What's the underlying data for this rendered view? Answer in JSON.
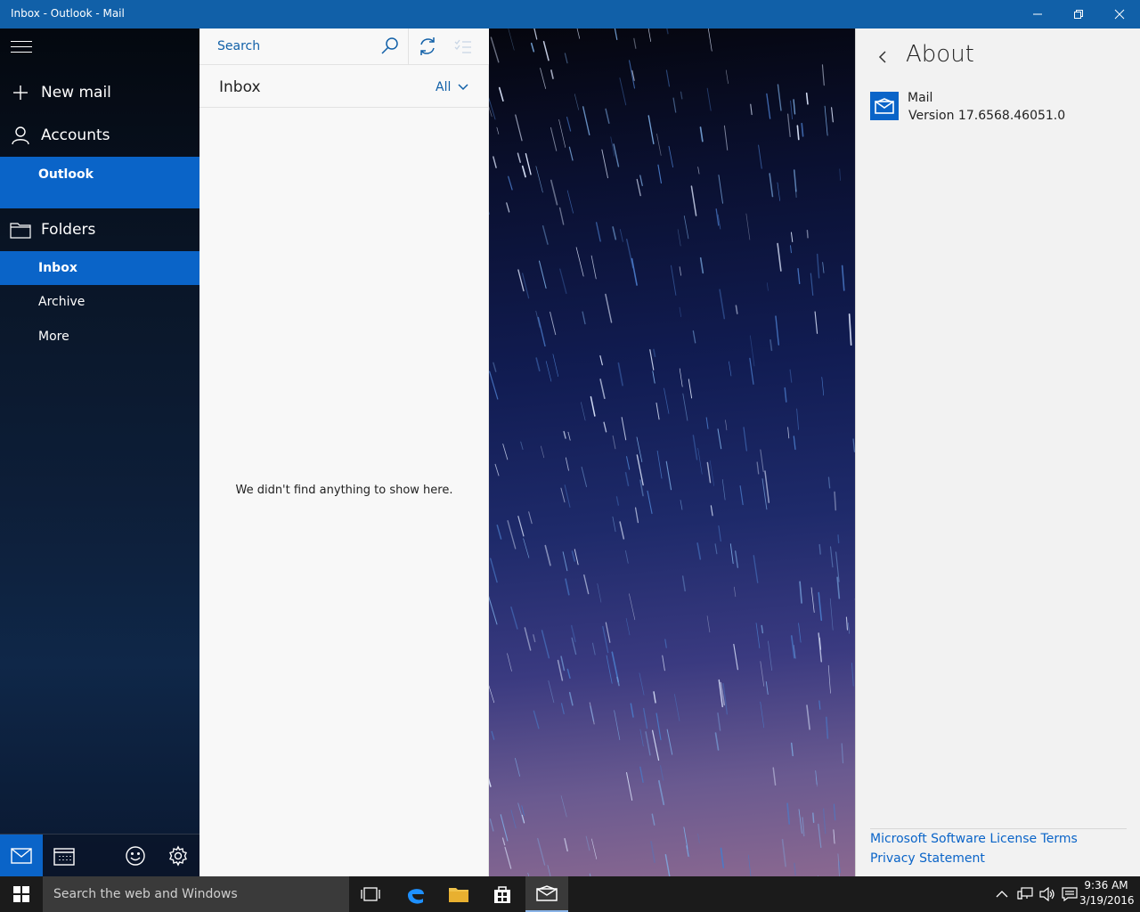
{
  "window": {
    "title": "Inbox - Outlook - Mail"
  },
  "nav": {
    "new_mail": "New mail",
    "accounts": "Accounts",
    "account_name": "Outlook",
    "folders": "Folders",
    "folder_items": [
      "Inbox",
      "Archive",
      "More"
    ]
  },
  "list": {
    "search_placeholder": "Search",
    "heading": "Inbox",
    "filter": "All",
    "empty_message": "We didn't find anything to show here."
  },
  "about": {
    "heading": "About",
    "app_name": "Mail",
    "version": "Version 17.6568.46051.0",
    "license_link": "Microsoft Software License Terms",
    "privacy_link": "Privacy Statement"
  },
  "taskbar": {
    "search_placeholder": "Search the web and Windows",
    "time": "9:36 AM",
    "date": "3/19/2016"
  },
  "colors": {
    "accent": "#0a64c8",
    "titlebar": "#1160a8",
    "taskbar": "#1b1b1b"
  }
}
